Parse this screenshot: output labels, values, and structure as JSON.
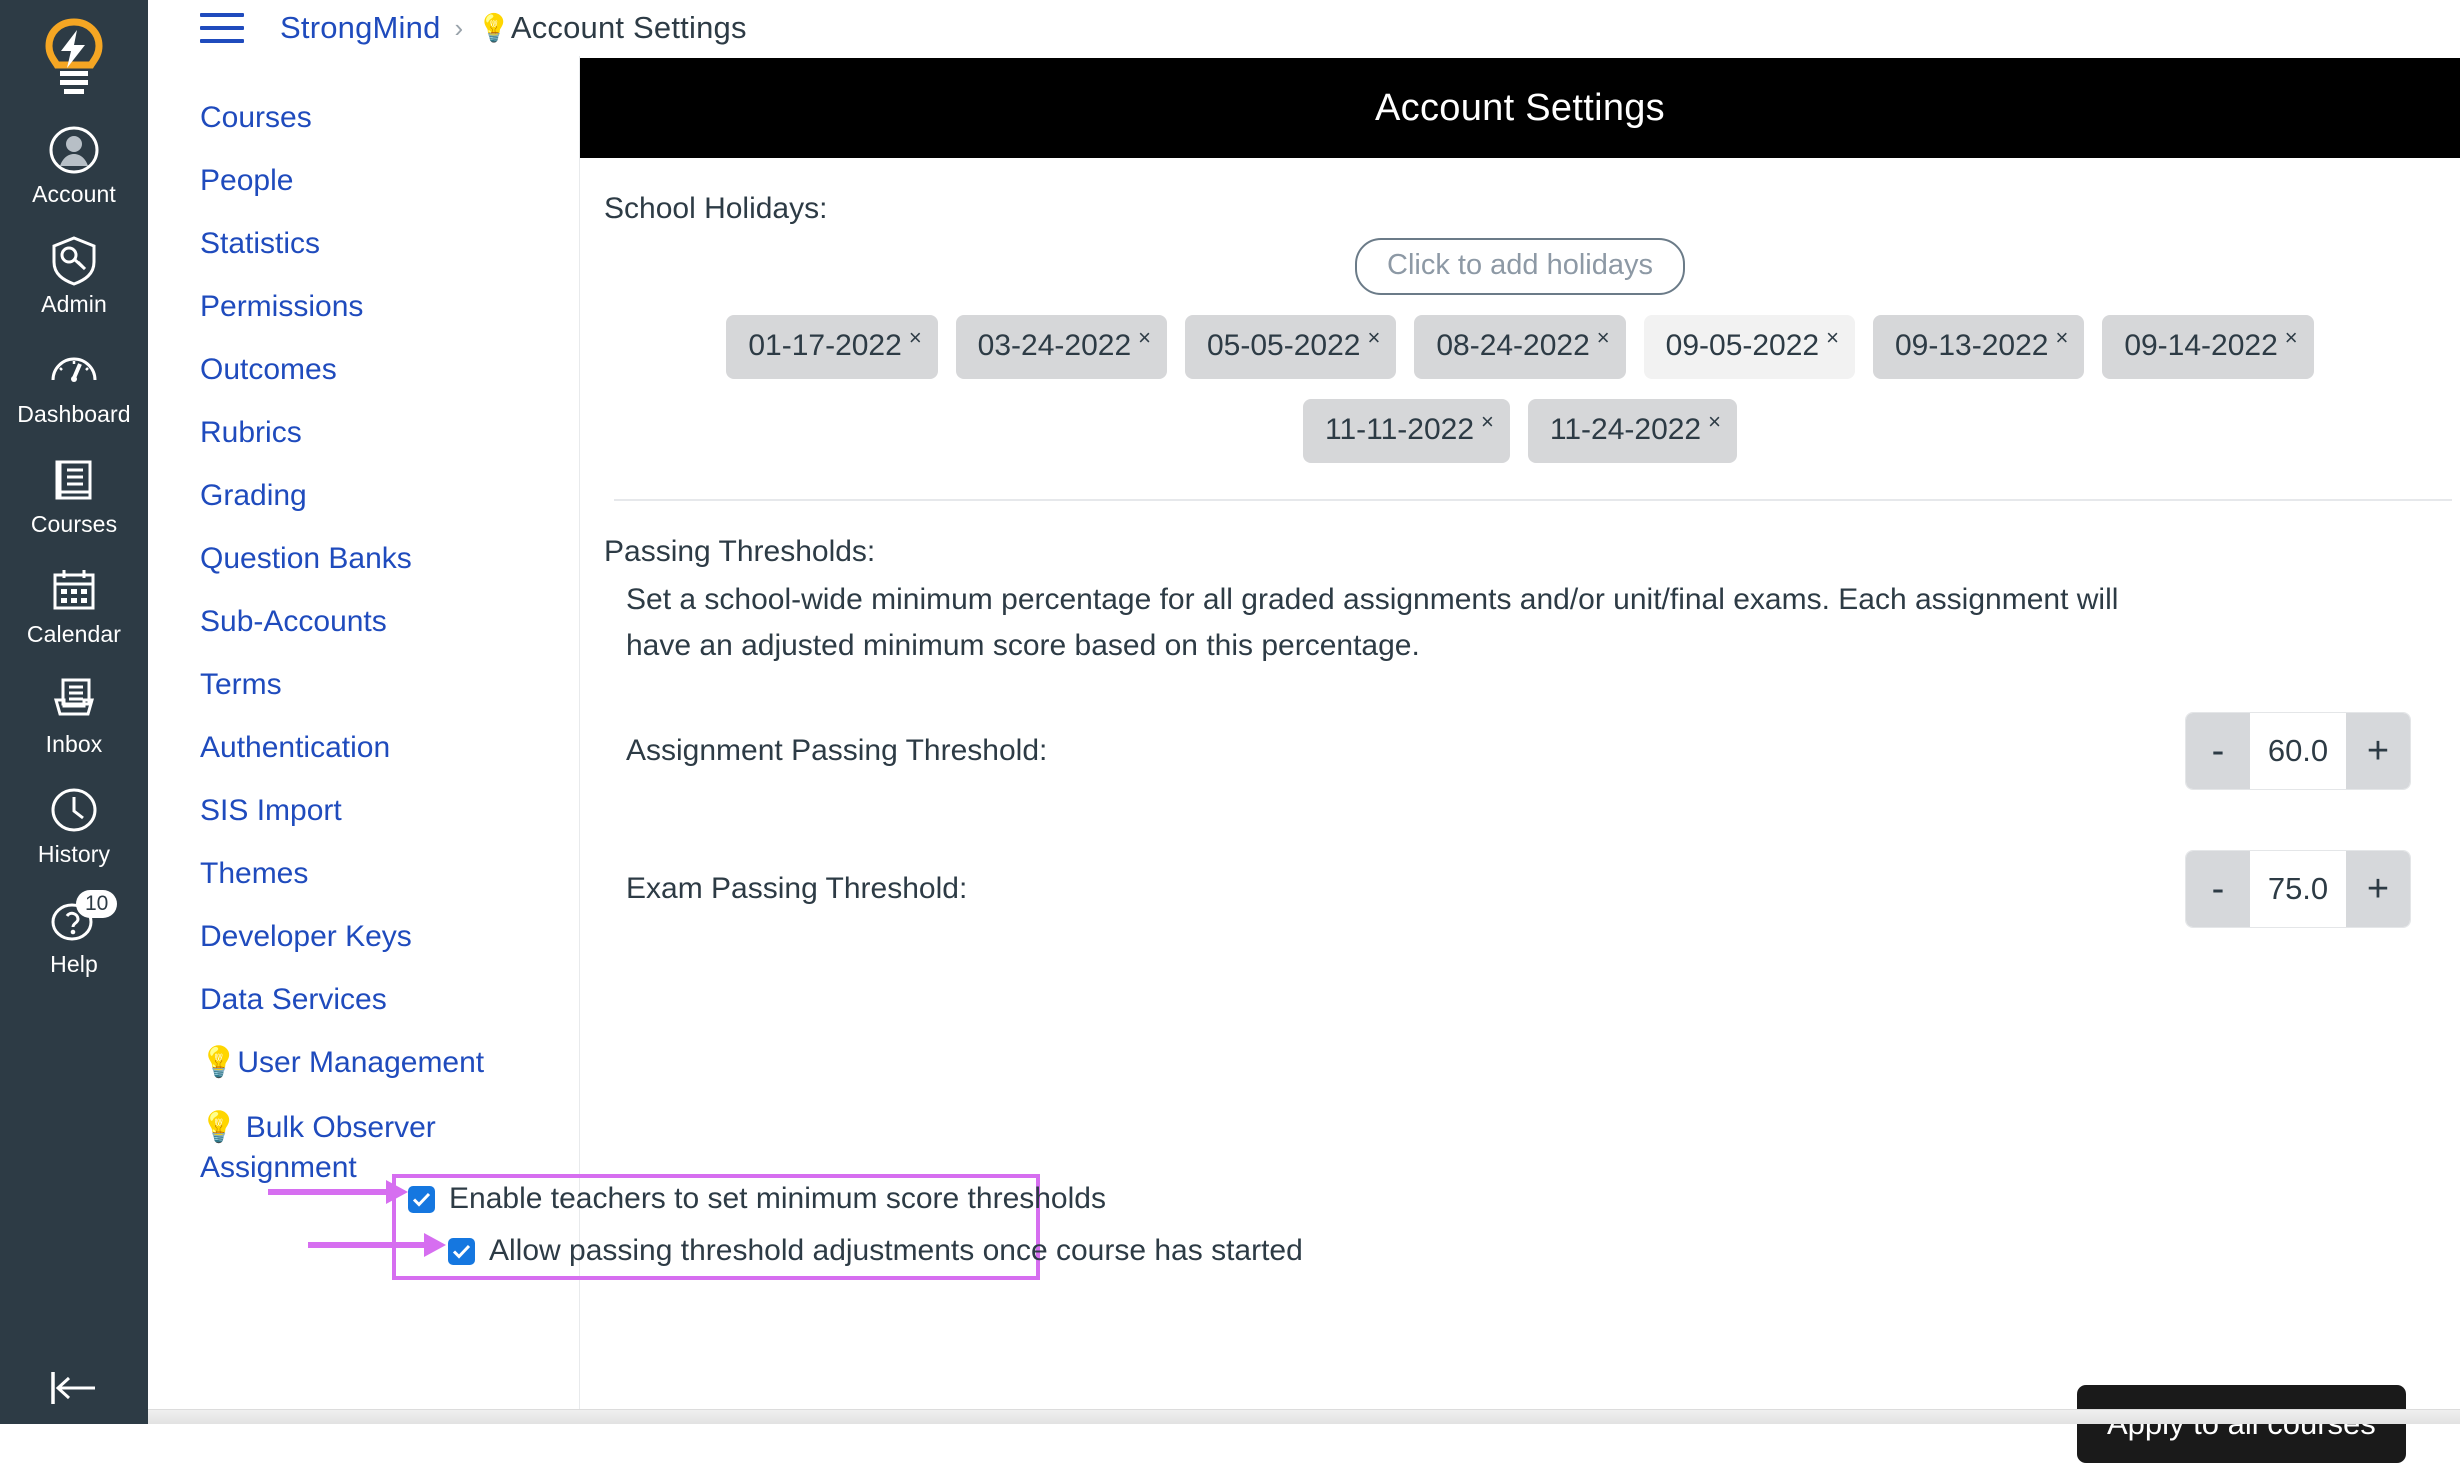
{
  "app_rail": {
    "logo_icon": "lightbulb-logo",
    "items": [
      {
        "label": "Account",
        "icon": "user-avatar-icon"
      },
      {
        "label": "Admin",
        "icon": "shield-key-icon"
      },
      {
        "label": "Dashboard",
        "icon": "gauge-icon"
      },
      {
        "label": "Courses",
        "icon": "book-icon"
      },
      {
        "label": "Calendar",
        "icon": "calendar-icon"
      },
      {
        "label": "Inbox",
        "icon": "inbox-tray-icon"
      },
      {
        "label": "History",
        "icon": "clock-icon"
      },
      {
        "label": "Help",
        "icon": "question-bubble-icon",
        "badge": "10"
      }
    ],
    "collapse_icon": "collapse-left-icon"
  },
  "breadcrumb": {
    "menu_icon": "hamburger-menu-icon",
    "root": "StrongMind",
    "separator": "›",
    "current_bulb": "💡",
    "current": "Account Settings"
  },
  "section_nav": {
    "items": [
      {
        "label": "Courses"
      },
      {
        "label": "People"
      },
      {
        "label": "Statistics"
      },
      {
        "label": "Permissions"
      },
      {
        "label": "Outcomes"
      },
      {
        "label": "Rubrics"
      },
      {
        "label": "Grading"
      },
      {
        "label": "Question Banks"
      },
      {
        "label": "Sub-Accounts"
      },
      {
        "label": "Terms"
      },
      {
        "label": "Authentication"
      },
      {
        "label": "SIS Import"
      },
      {
        "label": "Themes"
      },
      {
        "label": "Developer Keys"
      },
      {
        "label": "Data Services"
      },
      {
        "label": "💡User Management"
      },
      {
        "label": "💡 Bulk Observer Assignment"
      }
    ]
  },
  "main": {
    "banner_title": "Account Settings",
    "holidays": {
      "label": "School Holidays:",
      "add_button": "Click to add holidays",
      "remove_icon": "×",
      "dates_row1": [
        "01-17-2022",
        "03-24-2022",
        "05-05-2022",
        "08-24-2022",
        "09-05-2022",
        "09-13-2022",
        "09-14-2022"
      ],
      "dates_row2": [
        "11-11-2022",
        "11-24-2022"
      ],
      "hovered_date": "09-05-2022"
    },
    "thresholds": {
      "heading": "Passing Thresholds:",
      "description": "Set a school-wide minimum percentage for all graded assignments and/or unit/final exams. Each assignment will have an adjusted minimum score based on this percentage.",
      "assignment_label": "Assignment Passing Threshold:",
      "assignment_value": "60.0",
      "exam_label": "Exam Passing Threshold:",
      "exam_value": "75.0",
      "decrement_label": "-",
      "increment_label": "+"
    },
    "checkboxes": [
      {
        "label": "Enable teachers to set minimum score thresholds",
        "checked": true
      },
      {
        "label": "Allow passing threshold adjustments once course has started",
        "checked": true
      }
    ],
    "apply_button": "Apply to all courses"
  },
  "colors": {
    "rail_bg": "#2D3B45",
    "link_blue": "#1f4bbd",
    "banner_bg": "#000000",
    "highlight_purple": "#d66ef0",
    "checkbox_blue": "#1577e0",
    "chip_bg": "#d6d7d9",
    "chip_hover_bg": "#f2f2f2",
    "button_dark": "#1a1a1a"
  }
}
